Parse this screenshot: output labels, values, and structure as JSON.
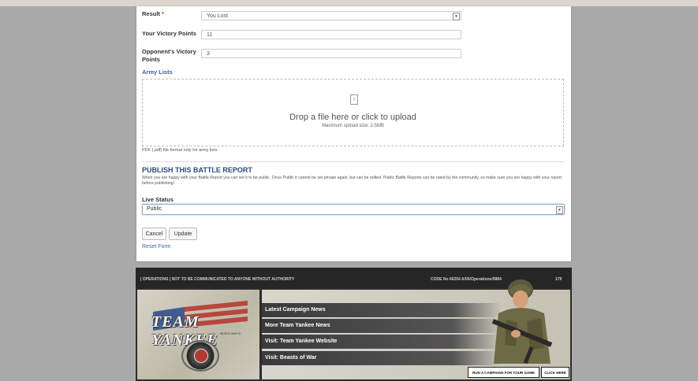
{
  "form": {
    "result": {
      "label": "Result",
      "required_mark": "*",
      "value": "You Lost"
    },
    "your_vp": {
      "label": "Your Victory Points",
      "value": "11"
    },
    "opp_vp": {
      "label_line1": "Opponent's Victory",
      "label_line2": "Points",
      "value": "3"
    },
    "army_lists": {
      "heading": "Army Lists",
      "drop_text": "Drop a file here or click to upload",
      "max_size": "Maximum upload size: 2.5MB",
      "hint": "PDF (.pdf) file format only for army lists."
    },
    "publish": {
      "title": "PUBLISH THIS BATTLE REPORT",
      "description": "When you are happy with your Battle Report you can set it to be public. Once Public it cannot be set private again, but can be edited. Public Battle Reports can be rated by the community, so make sure you are happy with your report before publishing!",
      "live_status_label": "Live Status",
      "live_status_value": "Public"
    },
    "buttons": {
      "cancel": "Cancel",
      "update": "Update"
    },
    "reset_link": "Reset Form"
  },
  "footer": {
    "left_text": "| OPERATIONS | NOT TO BE COMMUNICATED TO ANYONE WITHOUT AUTHORITY",
    "code_text": "CODE No 66254 A/55/Operations/5884",
    "page_no": "179",
    "logo": "TEAM YANKEE",
    "logo_sub": "WORLD WAR III",
    "links": [
      "Latest Campaign News",
      "More Team Yankee News",
      "Visit: Team Yankee Website",
      "Visit: Beasts of War"
    ],
    "cta_campaign": "RUN A CAMPAIGN FOR YOUR GAME",
    "cta_click": "CLICK HERE"
  }
}
